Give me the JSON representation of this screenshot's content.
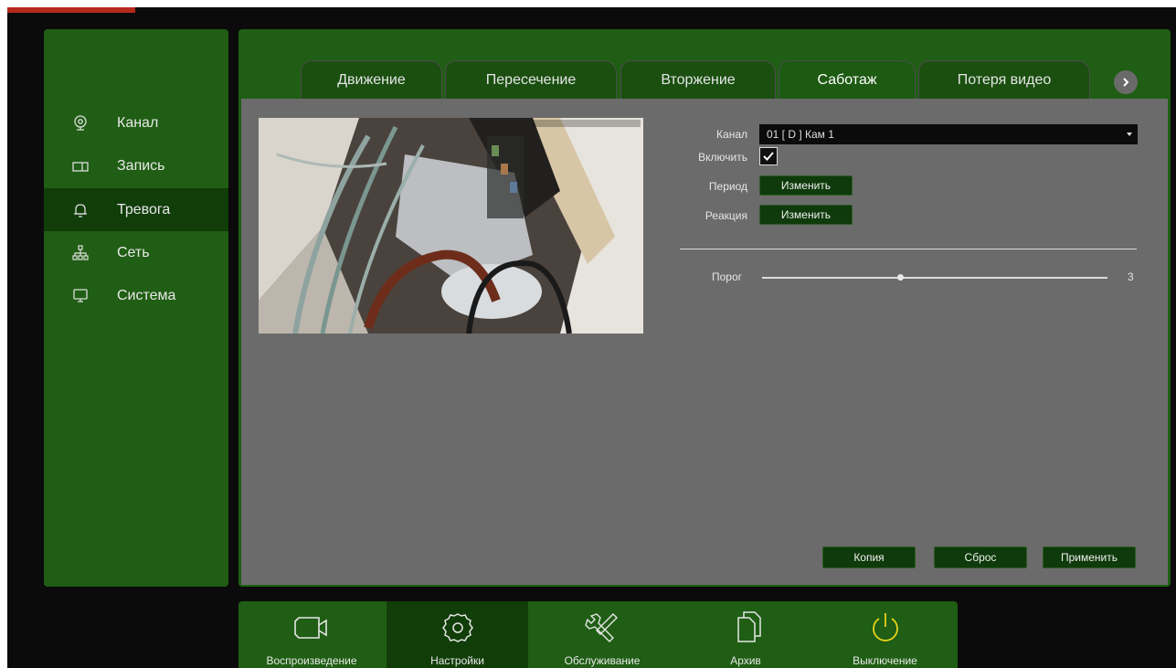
{
  "sidebar": {
    "items": [
      {
        "label": "Канал",
        "icon": "camera-channel-icon"
      },
      {
        "label": "Запись",
        "icon": "record-icon"
      },
      {
        "label": "Тревога",
        "icon": "bell-icon"
      },
      {
        "label": "Сеть",
        "icon": "network-icon"
      },
      {
        "label": "Система",
        "icon": "monitor-icon"
      }
    ],
    "active": "Тревога"
  },
  "tabs": [
    "Движение",
    "Пересечение",
    "Вторжение",
    "Саботаж",
    "Потеря видео"
  ],
  "active_tab": "Саботаж",
  "form": {
    "channel_label": "Канал",
    "channel_value": "01 [ D ] Кам 1",
    "enable_label": "Включить",
    "enable_checked": true,
    "period_label": "Период",
    "period_button": "Изменить",
    "reaction_label": "Реакция",
    "reaction_button": "Изменить",
    "threshold_label": "Порог",
    "threshold_value": "3",
    "threshold_fraction": 0.4
  },
  "actions": {
    "copy": "Копия",
    "reset": "Сброс",
    "apply": "Применить"
  },
  "dock": {
    "items": [
      {
        "label": "Воспроизведение",
        "icon": "video-camera-icon"
      },
      {
        "label": "Настройки",
        "icon": "gear-icon"
      },
      {
        "label": "Обслуживание",
        "icon": "tools-icon"
      },
      {
        "label": "Архив",
        "icon": "files-icon"
      },
      {
        "label": "Выключение",
        "icon": "power-icon"
      }
    ],
    "active": "Настройки"
  },
  "colors": {
    "panel_green": "#1f5e14",
    "active_green": "#113d09",
    "content_gray": "#6b6b6b",
    "power_yellow": "#e8d21c"
  }
}
